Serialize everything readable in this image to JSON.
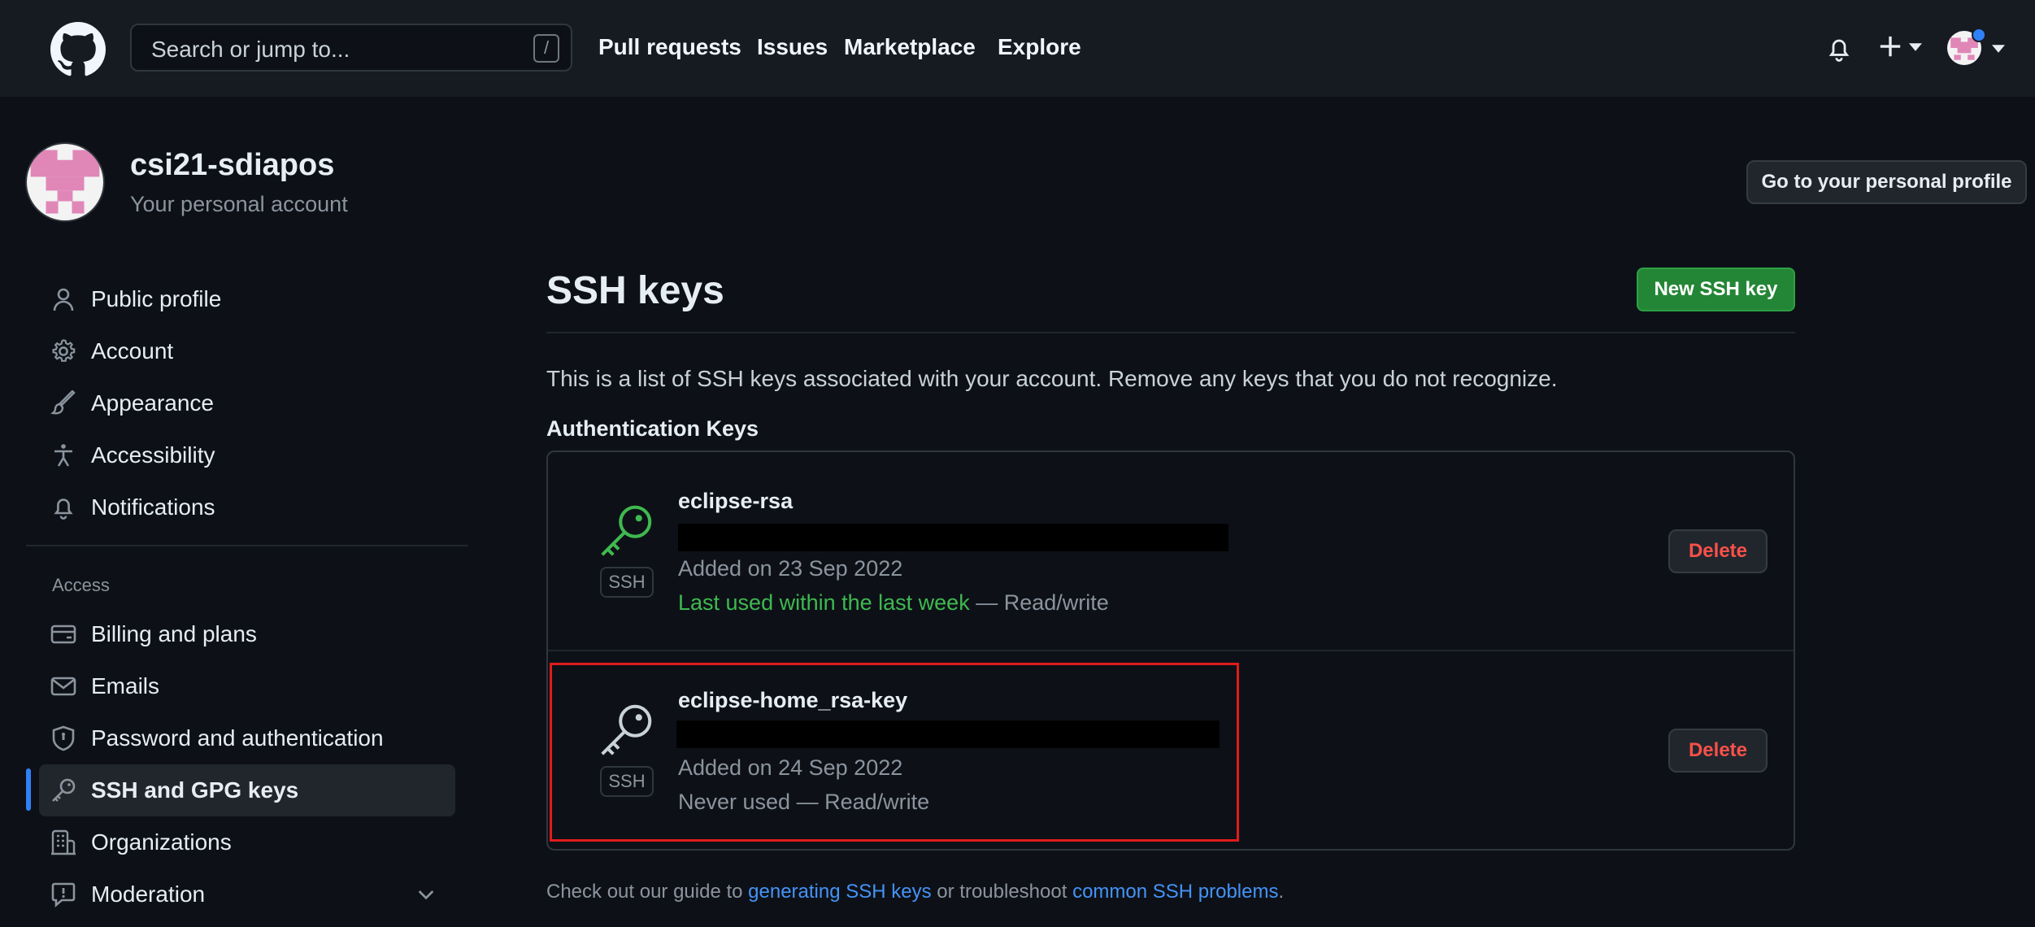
{
  "header": {
    "search_placeholder": "Search or jump to...",
    "search_shortcut": "/",
    "nav": [
      "Pull requests",
      "Issues",
      "Marketplace",
      "Explore"
    ]
  },
  "account": {
    "name": "csi21-sdiapos",
    "subtitle": "Your personal account",
    "profile_button": "Go to your personal profile"
  },
  "sidebar": {
    "items": [
      {
        "label": "Public profile",
        "icon": "person-icon"
      },
      {
        "label": "Account",
        "icon": "gear-icon"
      },
      {
        "label": "Appearance",
        "icon": "paintbrush-icon"
      },
      {
        "label": "Accessibility",
        "icon": "accessibility-icon"
      },
      {
        "label": "Notifications",
        "icon": "bell-icon"
      }
    ],
    "access_heading": "Access",
    "access_items": [
      {
        "label": "Billing and plans",
        "icon": "credit-card-icon"
      },
      {
        "label": "Emails",
        "icon": "mail-icon"
      },
      {
        "label": "Password and authentication",
        "icon": "shield-icon"
      },
      {
        "label": "SSH and GPG keys",
        "icon": "key-icon",
        "active": true
      },
      {
        "label": "Organizations",
        "icon": "organization-icon"
      },
      {
        "label": "Moderation",
        "icon": "report-icon"
      }
    ]
  },
  "main": {
    "title": "SSH keys",
    "new_key_button": "New SSH key",
    "intro": "This is a list of SSH keys associated with your account. Remove any keys that you do not recognize.",
    "section_heading": "Authentication Keys",
    "keys": [
      {
        "title": "eclipse-rsa",
        "badge": "SSH",
        "added": "Added on 23 Sep 2022",
        "usage_highlight": "Last used within the last week",
        "usage_rest": " — Read/write",
        "delete_label": "Delete",
        "icon_color": "#3fb950"
      },
      {
        "title": "eclipse-home_rsa-key",
        "badge": "SSH",
        "added": "Added on 24 Sep 2022",
        "usage_highlight": "",
        "usage_rest": "Never used — Read/write",
        "delete_label": "Delete",
        "icon_color": "#c9d1d9"
      }
    ],
    "footer": {
      "prefix": "Check out our guide to ",
      "link1": "generating SSH keys",
      "middle": " or troubleshoot ",
      "link2": "common SSH problems",
      "suffix": "."
    }
  },
  "colors": {
    "background": "#0d1117",
    "header": "#161b22",
    "accent_blue": "#2f81f7",
    "primary_green": "#238636",
    "danger_red": "#f85149",
    "highlight_box": "#e01b1b"
  }
}
